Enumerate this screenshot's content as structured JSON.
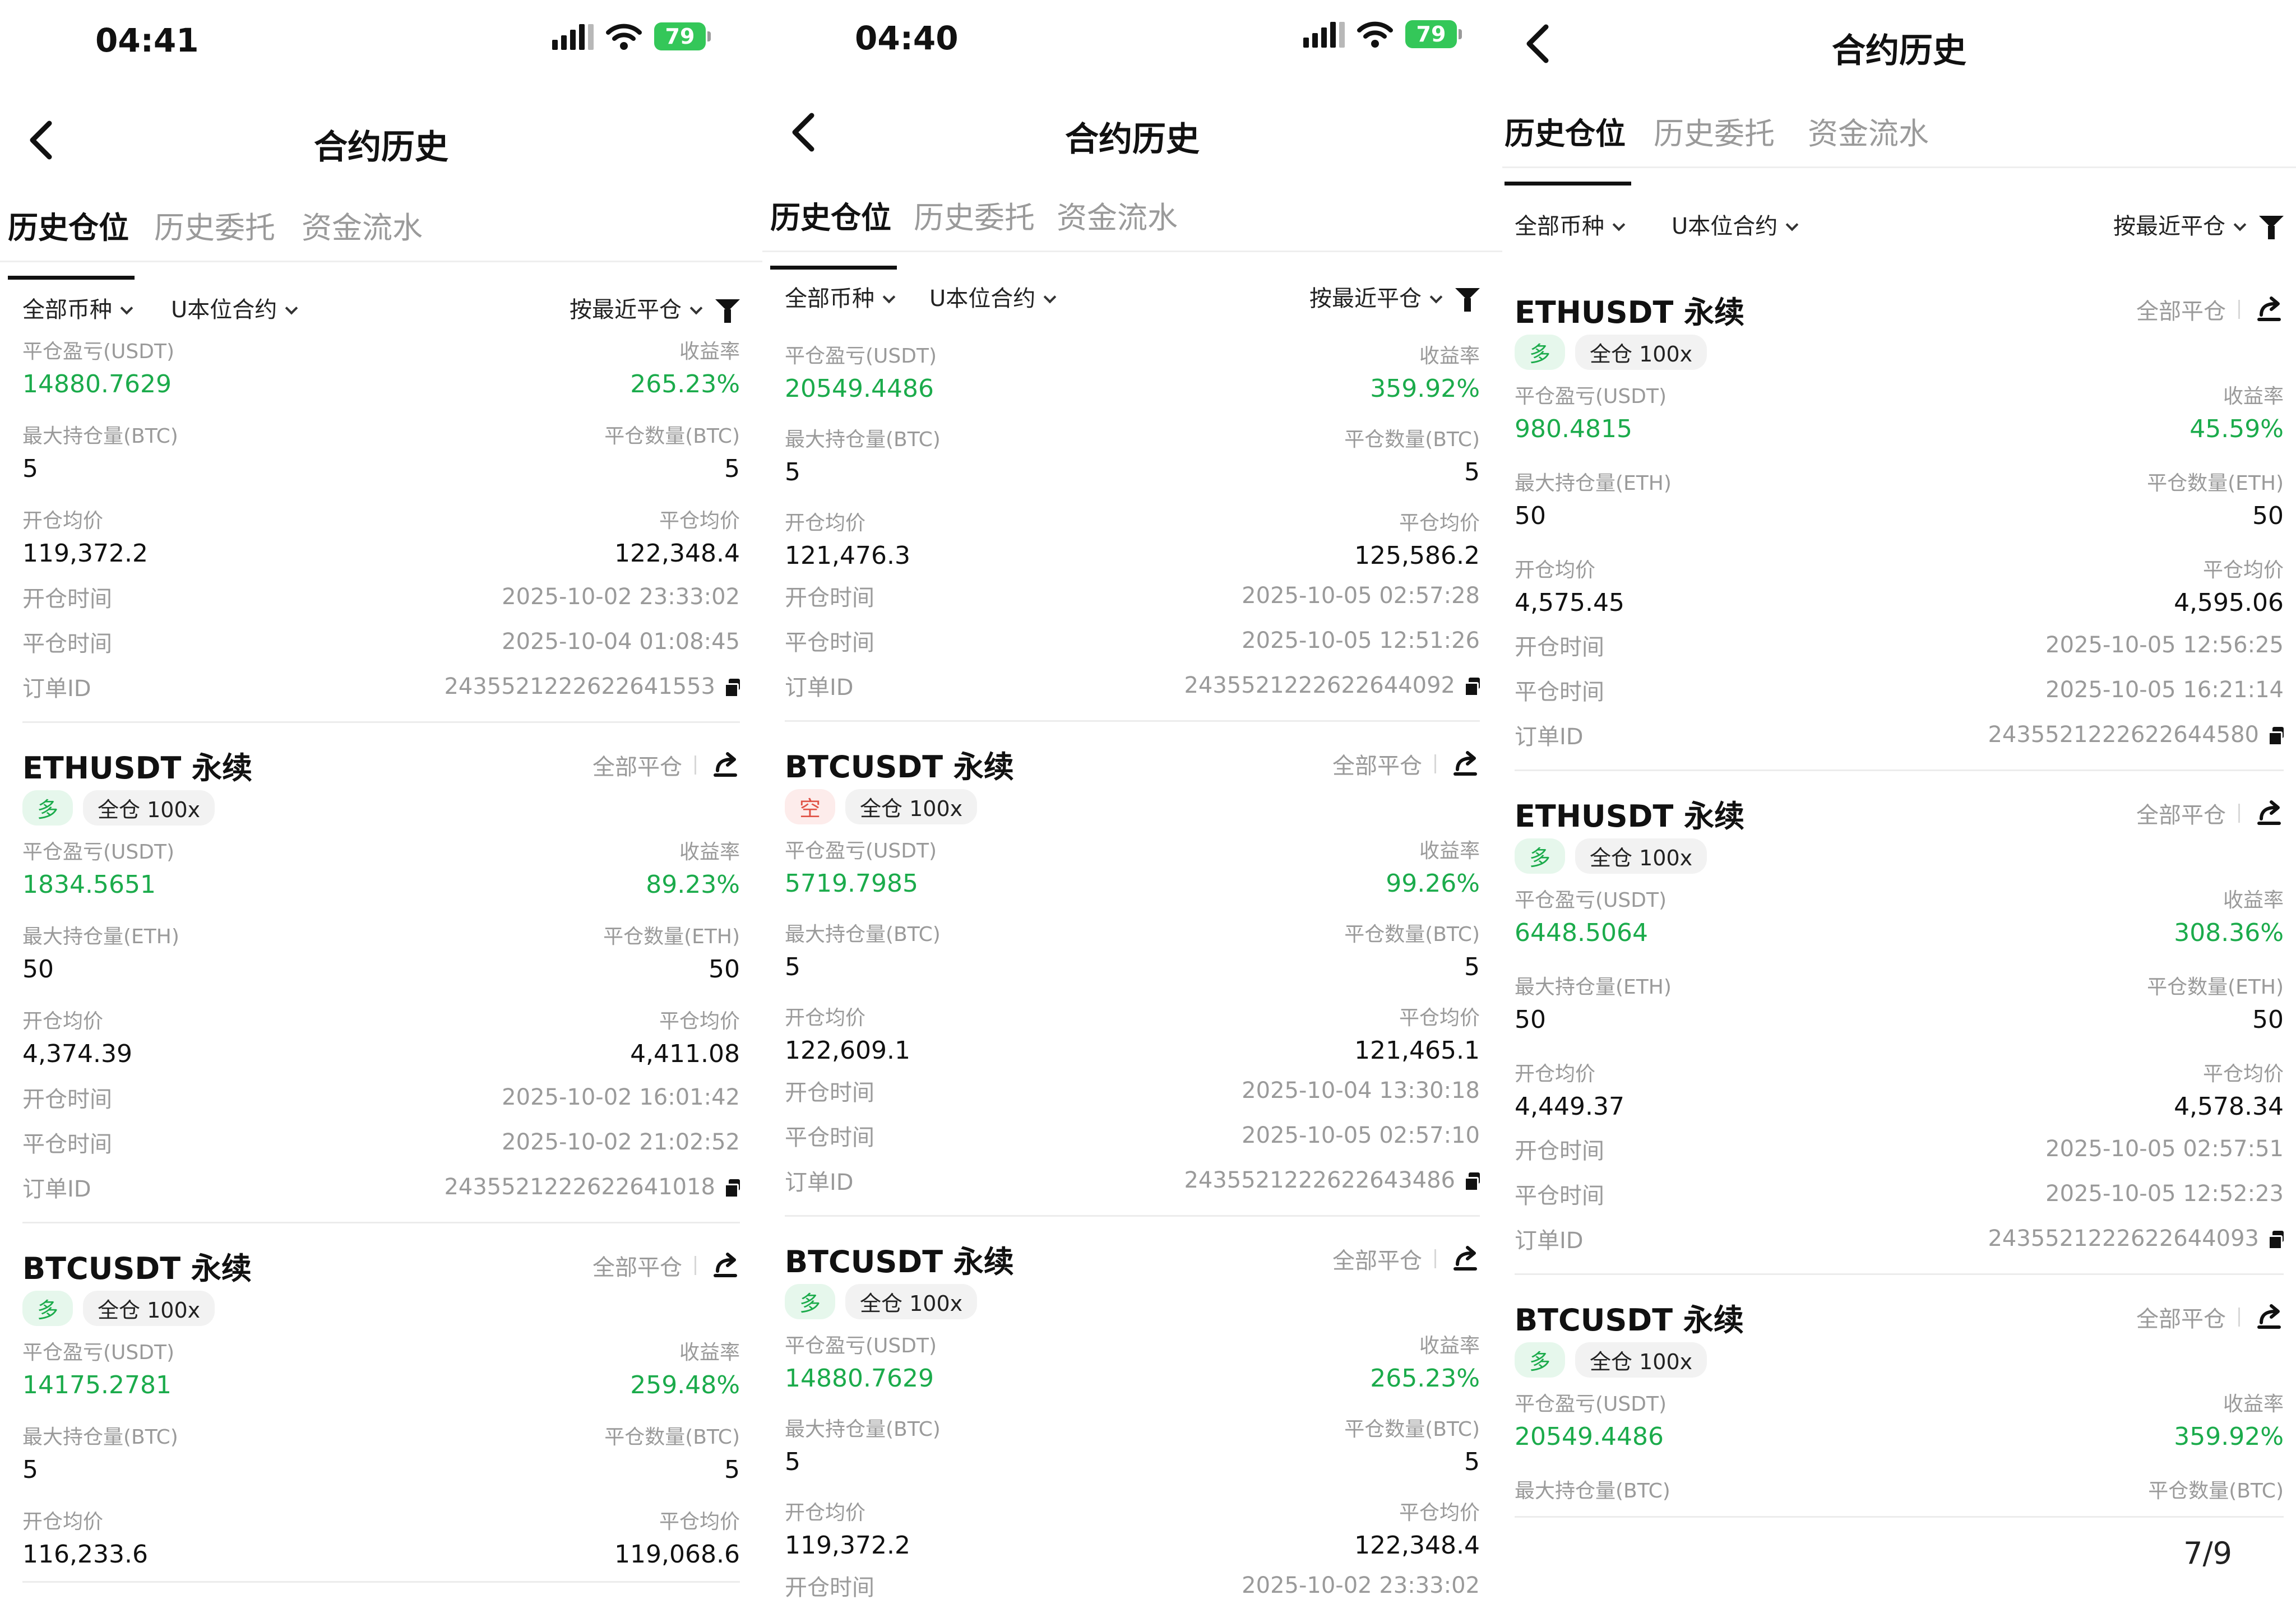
{
  "screens": [
    {
      "status": {
        "time": "04:41",
        "battery": "79"
      },
      "nav": {
        "title": "合约历史"
      },
      "tabs": [
        "历史仓位",
        "历史委托",
        "资金流水"
      ],
      "filters": {
        "coin": "全部币种",
        "contract": "U本位合约",
        "sort": "按最近平仓"
      },
      "cards": [
        {
          "top_fields_only": true,
          "pnl_label": "平仓盈亏(USDT)",
          "pnl": "14880.7629",
          "roe_label": "收益率",
          "roe": "265.23%",
          "max_label": "最大持仓量(BTC)",
          "max": "5",
          "qty_label": "平仓数量(BTC)",
          "qty": "5",
          "open_avg_label": "开仓均价",
          "open_avg": "119,372.2",
          "close_avg_label": "平仓均价",
          "close_avg": "122,348.4",
          "open_time_label": "开仓时间",
          "open_time": "2025-10-02 23:33:02",
          "close_time_label": "平仓时间",
          "close_time": "2025-10-04 01:08:45",
          "order_label": "订单ID",
          "order_id": "2435521222622641553"
        },
        {
          "symbol": "ETHUSDT 永续",
          "close_all": "全部平仓",
          "side": "多",
          "side_type": "long",
          "margin": "全仓 100x",
          "pnl_label": "平仓盈亏(USDT)",
          "pnl": "1834.5651",
          "roe_label": "收益率",
          "roe": "89.23%",
          "max_label": "最大持仓量(ETH)",
          "max": "50",
          "qty_label": "平仓数量(ETH)",
          "qty": "50",
          "open_avg_label": "开仓均价",
          "open_avg": "4,374.39",
          "close_avg_label": "平仓均价",
          "close_avg": "4,411.08",
          "open_time_label": "开仓时间",
          "open_time": "2025-10-02 16:01:42",
          "close_time_label": "平仓时间",
          "close_time": "2025-10-02 21:02:52",
          "order_label": "订单ID",
          "order_id": "2435521222622641018"
        },
        {
          "symbol": "BTCUSDT 永续",
          "close_all": "全部平仓",
          "side": "多",
          "side_type": "long",
          "margin": "全仓 100x",
          "pnl_label": "平仓盈亏(USDT)",
          "pnl": "14175.2781",
          "roe_label": "收益率",
          "roe": "259.48%",
          "max_label": "最大持仓量(BTC)",
          "max": "5",
          "qty_label": "平仓数量(BTC)",
          "qty": "5",
          "open_avg_label": "开仓均价",
          "open_avg": "116,233.6",
          "close_avg_label": "平仓均价",
          "close_avg": "119,068.6"
        }
      ]
    },
    {
      "status": {
        "time": "04:40",
        "battery": "79"
      },
      "nav": {
        "title": "合约历史"
      },
      "tabs": [
        "历史仓位",
        "历史委托",
        "资金流水"
      ],
      "filters": {
        "coin": "全部币种",
        "contract": "U本位合约",
        "sort": "按最近平仓"
      },
      "cards": [
        {
          "top_fields_only": true,
          "pnl_label": "平仓盈亏(USDT)",
          "pnl": "20549.4486",
          "roe_label": "收益率",
          "roe": "359.92%",
          "max_label": "最大持仓量(BTC)",
          "max": "5",
          "qty_label": "平仓数量(BTC)",
          "qty": "5",
          "open_avg_label": "开仓均价",
          "open_avg": "121,476.3",
          "close_avg_label": "平仓均价",
          "close_avg": "125,586.2",
          "open_time_label": "开仓时间",
          "open_time": "2025-10-05 02:57:28",
          "close_time_label": "平仓时间",
          "close_time": "2025-10-05 12:51:26",
          "order_label": "订单ID",
          "order_id": "2435521222622644092"
        },
        {
          "symbol": "BTCUSDT 永续",
          "close_all": "全部平仓",
          "side": "空",
          "side_type": "short",
          "margin": "全仓 100x",
          "pnl_label": "平仓盈亏(USDT)",
          "pnl": "5719.7985",
          "roe_label": "收益率",
          "roe": "99.26%",
          "max_label": "最大持仓量(BTC)",
          "max": "5",
          "qty_label": "平仓数量(BTC)",
          "qty": "5",
          "open_avg_label": "开仓均价",
          "open_avg": "122,609.1",
          "close_avg_label": "平仓均价",
          "close_avg": "121,465.1",
          "open_time_label": "开仓时间",
          "open_time": "2025-10-04 13:30:18",
          "close_time_label": "平仓时间",
          "close_time": "2025-10-05 02:57:10",
          "order_label": "订单ID",
          "order_id": "2435521222622643486"
        },
        {
          "symbol": "BTCUSDT 永续",
          "close_all": "全部平仓",
          "side": "多",
          "side_type": "long",
          "margin": "全仓 100x",
          "pnl_label": "平仓盈亏(USDT)",
          "pnl": "14880.7629",
          "roe_label": "收益率",
          "roe": "265.23%",
          "max_label": "最大持仓量(BTC)",
          "max": "5",
          "qty_label": "平仓数量(BTC)",
          "qty": "5",
          "open_avg_label": "开仓均价",
          "open_avg": "119,372.2",
          "close_avg_label": "平仓均价",
          "close_avg": "122,348.4",
          "open_time_label": "开仓时间",
          "open_time": "2025-10-02 23:33:02"
        }
      ]
    },
    {
      "nav": {
        "title": "合约历史"
      },
      "tabs": [
        "历史仓位",
        "历史委托",
        "资金流水"
      ],
      "filters": {
        "coin": "全部币种",
        "contract": "U本位合约",
        "sort": "按最近平仓"
      },
      "cards": [
        {
          "symbol": "ETHUSDT 永续",
          "close_all": "全部平仓",
          "side": "多",
          "side_type": "long",
          "margin": "全仓 100x",
          "pnl_label": "平仓盈亏(USDT)",
          "pnl": "980.4815",
          "roe_label": "收益率",
          "roe": "45.59%",
          "max_label": "最大持仓量(ETH)",
          "max": "50",
          "qty_label": "平仓数量(ETH)",
          "qty": "50",
          "open_avg_label": "开仓均价",
          "open_avg": "4,575.45",
          "close_avg_label": "平仓均价",
          "close_avg": "4,595.06",
          "open_time_label": "开仓时间",
          "open_time": "2025-10-05 12:56:25",
          "close_time_label": "平仓时间",
          "close_time": "2025-10-05 16:21:14",
          "order_label": "订单ID",
          "order_id": "2435521222622644580"
        },
        {
          "symbol": "ETHUSDT 永续",
          "close_all": "全部平仓",
          "side": "多",
          "side_type": "long",
          "margin": "全仓 100x",
          "pnl_label": "平仓盈亏(USDT)",
          "pnl": "6448.5064",
          "roe_label": "收益率",
          "roe": "308.36%",
          "max_label": "最大持仓量(ETH)",
          "max": "50",
          "qty_label": "平仓数量(ETH)",
          "qty": "50",
          "open_avg_label": "开仓均价",
          "open_avg": "4,449.37",
          "close_avg_label": "平仓均价",
          "close_avg": "4,578.34",
          "open_time_label": "开仓时间",
          "open_time": "2025-10-05 02:57:51",
          "close_time_label": "平仓时间",
          "close_time": "2025-10-05 12:52:23",
          "order_label": "订单ID",
          "order_id": "2435521222622644093"
        },
        {
          "symbol": "BTCUSDT 永续",
          "close_all": "全部平仓",
          "side": "多",
          "side_type": "long",
          "margin": "全仓 100x",
          "pnl_label": "平仓盈亏(USDT)",
          "pnl": "20549.4486",
          "roe_label": "收益率",
          "roe": "359.92%",
          "max_label": "最大持仓量(BTC)",
          "qty_label": "平仓数量(BTC)"
        }
      ],
      "page_counter": "7/9"
    }
  ]
}
